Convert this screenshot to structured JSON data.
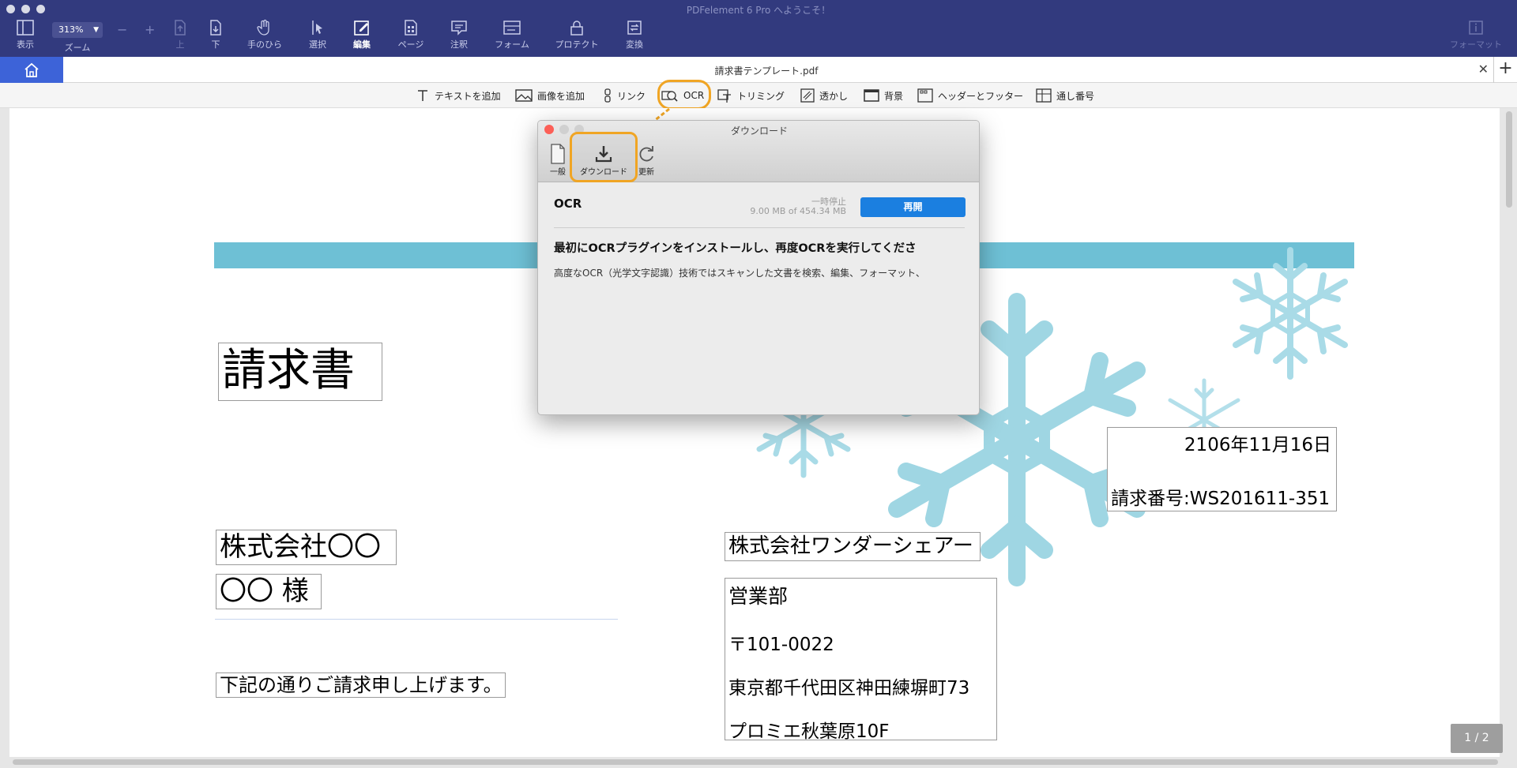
{
  "window": {
    "title": "PDFelement 6 Pro へようこそ！"
  },
  "toolbar": {
    "view": "表示",
    "zoom_value": "313%",
    "zoom_label": "ズーム",
    "zoom_out": "−",
    "zoom_in": "+",
    "up": "上",
    "down": "下",
    "hand": "手のひら",
    "select": "選択",
    "edit": "編集",
    "page": "ページ",
    "annotate": "注釈",
    "form": "フォーム",
    "protect": "プロテクト",
    "convert": "変換",
    "format": "フォーマット"
  },
  "tab": {
    "filename": "請求書テンプレート.pdf",
    "close": "✕",
    "add": "+"
  },
  "edit_toolbar": {
    "add_text": "テキストを追加",
    "add_image": "画像を追加",
    "link": "リンク",
    "ocr": "OCR",
    "trim": "トリミング",
    "watermark": "透かし",
    "background": "背景",
    "header_footer": "ヘッダーとフッター",
    "bates": "通し番号"
  },
  "dialog": {
    "title": "ダウンロード",
    "tab_general": "一般",
    "tab_download": "ダウンロード",
    "tab_update": "更新",
    "item_name": "OCR",
    "status": "一時停止",
    "size": "9.00 MB of 454.34 MB",
    "resume_button": "再開",
    "heading": "最初にOCRプラグインをインストールし、再度OCRを実行してくださ",
    "description": "高度なOCR（光学文字認識）技術ではスキャンした文書を検索、編集、フォーマット、"
  },
  "document": {
    "title": "請求書",
    "date": "2106年11月16日",
    "invoice_no": "請求番号:WS201611-351",
    "client_company": "株式会社〇〇",
    "client_name": "〇〇 様",
    "message": "下記の通りご請求申し上げます。",
    "issuer_company": "株式会社ワンダーシェアー",
    "issuer_dept": "営業部",
    "issuer_zip": "〒101-0022",
    "issuer_address": "東京都千代田区神田練塀町73",
    "issuer_building": "プロミエ秋葉原10F"
  },
  "page_indicator": "1 / 2",
  "colors": {
    "toolbar_bg": "#323a7e",
    "accent_blue": "#3d63d8",
    "highlight_orange": "#f0a524",
    "band_blue": "#6ec0d5",
    "snowflake_blue": "#9fd6e3",
    "resume_blue": "#1b7fe0"
  }
}
